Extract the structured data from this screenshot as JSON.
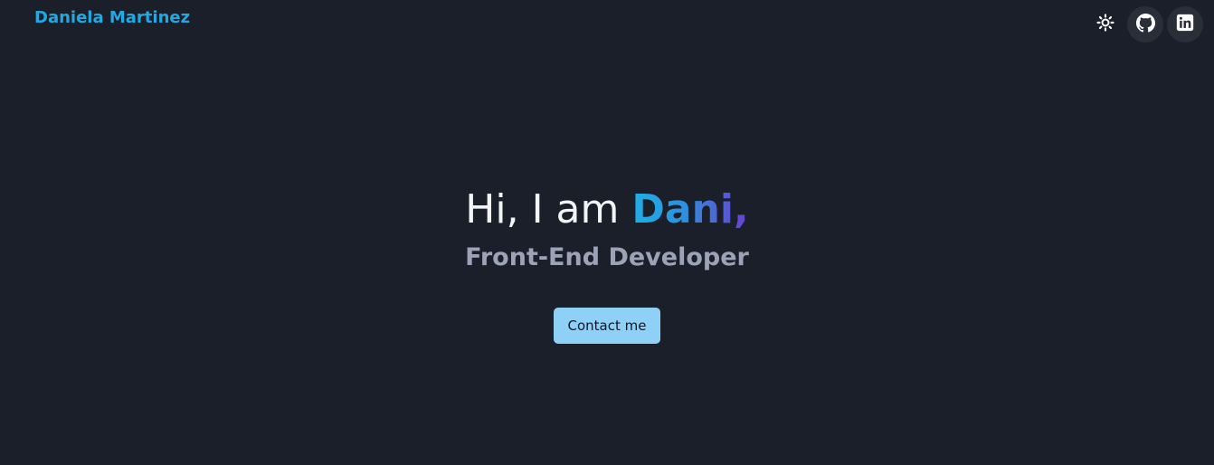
{
  "header": {
    "brand": "Daniela Martinez",
    "icons": {
      "theme": "sun-icon",
      "github": "github-icon",
      "linkedin": "linkedin-icon"
    }
  },
  "hero": {
    "greeting": "Hi, I am ",
    "name": "Dani,",
    "subtitle": "Front-End Developer",
    "cta_label": "Contact me"
  },
  "colors": {
    "background": "#1b1f2a",
    "brand": "#22a9e0",
    "name_gradient_start": "#1fb0e8",
    "name_gradient_end": "#6a3fd0",
    "button": "#8fd0f7",
    "icon_button_bg": "#2a2e38"
  }
}
